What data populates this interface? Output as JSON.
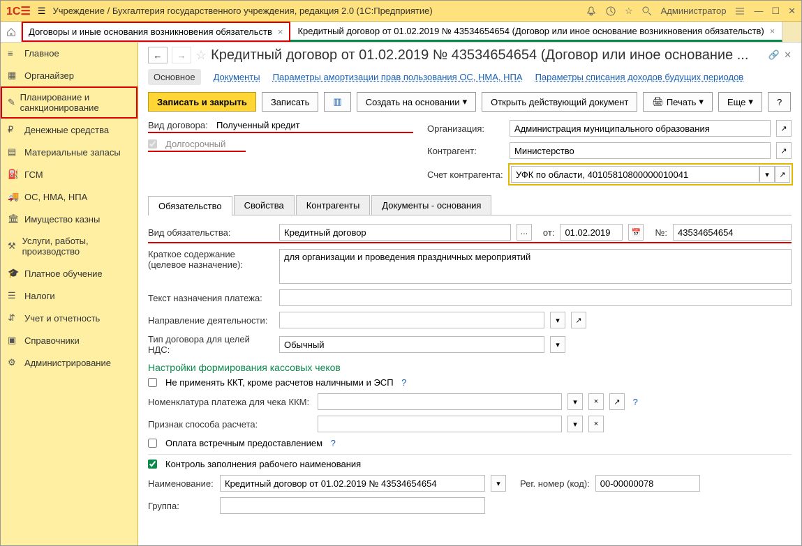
{
  "titlebar": {
    "app_title": "Учреждение / Бухгалтерия государственного учреждения, редакция 2.0  (1С:Предприятие)",
    "user": "Администратор"
  },
  "tabs": [
    {
      "label": "Договоры и иные основания возникновения обязательств"
    },
    {
      "label": "Кредитный договор от 01.02.2019 № 43534654654 (Договор или иное основание возникновения обязательств)"
    }
  ],
  "sidebar": {
    "items": [
      {
        "label": "Главное"
      },
      {
        "label": "Органайзер"
      },
      {
        "label": "Планирование и санкционирование"
      },
      {
        "label": "Денежные средства"
      },
      {
        "label": "Материальные запасы"
      },
      {
        "label": "ГСМ"
      },
      {
        "label": "ОС, НМА, НПА"
      },
      {
        "label": "Имущество казны"
      },
      {
        "label": "Услуги, работы, производство"
      },
      {
        "label": "Платное обучение"
      },
      {
        "label": "Налоги"
      },
      {
        "label": "Учет и отчетность"
      },
      {
        "label": "Справочники"
      },
      {
        "label": "Администрирование"
      }
    ]
  },
  "page": {
    "title": "Кредитный договор от 01.02.2019 № 43534654654 (Договор или иное основание ..."
  },
  "subtabs": {
    "main": "Основное",
    "docs": "Документы",
    "params_amort": "Параметры амортизации прав пользования ОС, НМА, НПА",
    "params_spis": "Параметры списания доходов будущих периодов"
  },
  "toolbar": {
    "save_close": "Записать и закрыть",
    "save": "Записать",
    "create_base": "Создать на основании",
    "open_doc": "Открыть действующий документ",
    "print": "Печать",
    "more": "Еще"
  },
  "form": {
    "vid_dogovora_lbl": "Вид договора:",
    "vid_dogovora_val": "Полученный кредит",
    "dolgosroch_lbl": "Долгосрочный",
    "org_lbl": "Организация:",
    "org_val": "Администрация муниципального образования",
    "kontragent_lbl": "Контрагент:",
    "kontragent_val": "Министерство",
    "schet_lbl": "Счет контрагента:",
    "schet_val": "УФК по области, 40105810800000010041"
  },
  "innertabs": {
    "t1": "Обязательство",
    "t2": "Свойства",
    "t3": "Контрагенты",
    "t4": "Документы - основания"
  },
  "obligation": {
    "vid_obyaz_lbl": "Вид обязательства:",
    "vid_obyaz_val": "Кредитный договор",
    "ot_lbl": "от:",
    "ot_val": "01.02.2019",
    "no_lbl": "№:",
    "no_val": "43534654654",
    "kratk_lbl": "Краткое содержание (целевое назначение):",
    "kratk_val": "для организации и проведения праздничных мероприятий",
    "tekst_lbl": "Текст назначения платежа:",
    "napr_lbl": "Направление деятельности:",
    "nds_lbl": "Тип договора для целей НДС:",
    "nds_val": "Обычный",
    "kkt_section": "Настройки формирования кассовых чеков",
    "kkt_skip_lbl": "Не применять ККТ, кроме расчетов наличными и ЭСП",
    "nomen_lbl": "Номенклатура платежа для чека ККМ:",
    "priznak_lbl": "Признак способа расчета:",
    "oplata_lbl": "Оплата встречным предоставлением",
    "kontrol_lbl": "Контроль заполнения рабочего наименования",
    "naimen_lbl": "Наименование:",
    "naimen_val": "Кредитный договор от 01.02.2019 № 43534654654",
    "regnom_lbl": "Рег. номер (код):",
    "regnom_val": "00-00000078",
    "gruppa_lbl": "Группа:"
  }
}
